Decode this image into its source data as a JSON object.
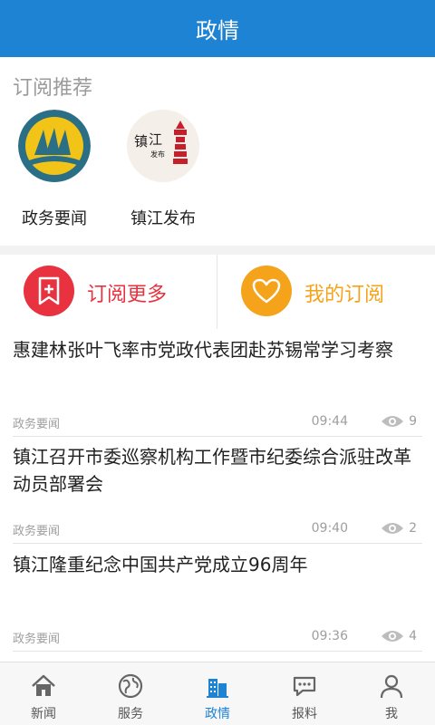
{
  "header": {
    "title": "政情"
  },
  "recommend": {
    "heading": "订阅推荐",
    "items": [
      {
        "name": "政务要闻",
        "icon": "government-news-logo-icon"
      },
      {
        "name": "镇江发布",
        "icon": "zhenjiang-release-logo-icon"
      }
    ]
  },
  "actions": {
    "subscribe_more": {
      "label": "订阅更多",
      "color": "#e8323f"
    },
    "my_subscriptions": {
      "label": "我的订阅",
      "color": "#f5a31a"
    }
  },
  "news": [
    {
      "title": "惠建林张叶飞率市党政代表团赴苏锡常学习考察",
      "category": "政务要闻",
      "time": "09:44",
      "views": "9"
    },
    {
      "title": "镇江召开市委巡察机构工作暨市纪委综合派驻改革动员部署会",
      "category": "政务要闻",
      "time": "09:40",
      "views": "2"
    },
    {
      "title": "镇江隆重纪念中国共产党成立96周年",
      "category": "政务要闻",
      "time": "09:36",
      "views": "4"
    }
  ],
  "tabs": [
    {
      "label": "新闻",
      "icon": "home-icon"
    },
    {
      "label": "服务",
      "icon": "globe-icon"
    },
    {
      "label": "政情",
      "icon": "buildings-icon"
    },
    {
      "label": "报料",
      "icon": "chat-icon"
    },
    {
      "label": "我",
      "icon": "person-icon"
    }
  ],
  "colors": {
    "primary": "#1e83d3"
  }
}
